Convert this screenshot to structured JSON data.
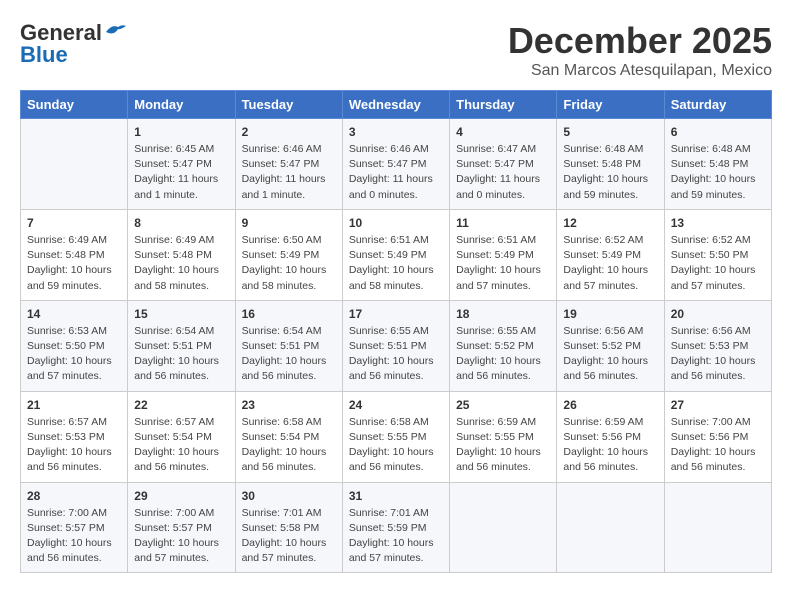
{
  "logo": {
    "general": "General",
    "blue": "Blue"
  },
  "title": "December 2025",
  "location": "San Marcos Atesquilapan, Mexico",
  "days_of_week": [
    "Sunday",
    "Monday",
    "Tuesday",
    "Wednesday",
    "Thursday",
    "Friday",
    "Saturday"
  ],
  "weeks": [
    [
      {
        "day": "",
        "info": ""
      },
      {
        "day": "1",
        "info": "Sunrise: 6:45 AM\nSunset: 5:47 PM\nDaylight: 11 hours\nand 1 minute."
      },
      {
        "day": "2",
        "info": "Sunrise: 6:46 AM\nSunset: 5:47 PM\nDaylight: 11 hours\nand 1 minute."
      },
      {
        "day": "3",
        "info": "Sunrise: 6:46 AM\nSunset: 5:47 PM\nDaylight: 11 hours\nand 0 minutes."
      },
      {
        "day": "4",
        "info": "Sunrise: 6:47 AM\nSunset: 5:47 PM\nDaylight: 11 hours\nand 0 minutes."
      },
      {
        "day": "5",
        "info": "Sunrise: 6:48 AM\nSunset: 5:48 PM\nDaylight: 10 hours\nand 59 minutes."
      },
      {
        "day": "6",
        "info": "Sunrise: 6:48 AM\nSunset: 5:48 PM\nDaylight: 10 hours\nand 59 minutes."
      }
    ],
    [
      {
        "day": "7",
        "info": "Sunrise: 6:49 AM\nSunset: 5:48 PM\nDaylight: 10 hours\nand 59 minutes."
      },
      {
        "day": "8",
        "info": "Sunrise: 6:49 AM\nSunset: 5:48 PM\nDaylight: 10 hours\nand 58 minutes."
      },
      {
        "day": "9",
        "info": "Sunrise: 6:50 AM\nSunset: 5:49 PM\nDaylight: 10 hours\nand 58 minutes."
      },
      {
        "day": "10",
        "info": "Sunrise: 6:51 AM\nSunset: 5:49 PM\nDaylight: 10 hours\nand 58 minutes."
      },
      {
        "day": "11",
        "info": "Sunrise: 6:51 AM\nSunset: 5:49 PM\nDaylight: 10 hours\nand 57 minutes."
      },
      {
        "day": "12",
        "info": "Sunrise: 6:52 AM\nSunset: 5:49 PM\nDaylight: 10 hours\nand 57 minutes."
      },
      {
        "day": "13",
        "info": "Sunrise: 6:52 AM\nSunset: 5:50 PM\nDaylight: 10 hours\nand 57 minutes."
      }
    ],
    [
      {
        "day": "14",
        "info": "Sunrise: 6:53 AM\nSunset: 5:50 PM\nDaylight: 10 hours\nand 57 minutes."
      },
      {
        "day": "15",
        "info": "Sunrise: 6:54 AM\nSunset: 5:51 PM\nDaylight: 10 hours\nand 56 minutes."
      },
      {
        "day": "16",
        "info": "Sunrise: 6:54 AM\nSunset: 5:51 PM\nDaylight: 10 hours\nand 56 minutes."
      },
      {
        "day": "17",
        "info": "Sunrise: 6:55 AM\nSunset: 5:51 PM\nDaylight: 10 hours\nand 56 minutes."
      },
      {
        "day": "18",
        "info": "Sunrise: 6:55 AM\nSunset: 5:52 PM\nDaylight: 10 hours\nand 56 minutes."
      },
      {
        "day": "19",
        "info": "Sunrise: 6:56 AM\nSunset: 5:52 PM\nDaylight: 10 hours\nand 56 minutes."
      },
      {
        "day": "20",
        "info": "Sunrise: 6:56 AM\nSunset: 5:53 PM\nDaylight: 10 hours\nand 56 minutes."
      }
    ],
    [
      {
        "day": "21",
        "info": "Sunrise: 6:57 AM\nSunset: 5:53 PM\nDaylight: 10 hours\nand 56 minutes."
      },
      {
        "day": "22",
        "info": "Sunrise: 6:57 AM\nSunset: 5:54 PM\nDaylight: 10 hours\nand 56 minutes."
      },
      {
        "day": "23",
        "info": "Sunrise: 6:58 AM\nSunset: 5:54 PM\nDaylight: 10 hours\nand 56 minutes."
      },
      {
        "day": "24",
        "info": "Sunrise: 6:58 AM\nSunset: 5:55 PM\nDaylight: 10 hours\nand 56 minutes."
      },
      {
        "day": "25",
        "info": "Sunrise: 6:59 AM\nSunset: 5:55 PM\nDaylight: 10 hours\nand 56 minutes."
      },
      {
        "day": "26",
        "info": "Sunrise: 6:59 AM\nSunset: 5:56 PM\nDaylight: 10 hours\nand 56 minutes."
      },
      {
        "day": "27",
        "info": "Sunrise: 7:00 AM\nSunset: 5:56 PM\nDaylight: 10 hours\nand 56 minutes."
      }
    ],
    [
      {
        "day": "28",
        "info": "Sunrise: 7:00 AM\nSunset: 5:57 PM\nDaylight: 10 hours\nand 56 minutes."
      },
      {
        "day": "29",
        "info": "Sunrise: 7:00 AM\nSunset: 5:57 PM\nDaylight: 10 hours\nand 57 minutes."
      },
      {
        "day": "30",
        "info": "Sunrise: 7:01 AM\nSunset: 5:58 PM\nDaylight: 10 hours\nand 57 minutes."
      },
      {
        "day": "31",
        "info": "Sunrise: 7:01 AM\nSunset: 5:59 PM\nDaylight: 10 hours\nand 57 minutes."
      },
      {
        "day": "",
        "info": ""
      },
      {
        "day": "",
        "info": ""
      },
      {
        "day": "",
        "info": ""
      }
    ]
  ]
}
